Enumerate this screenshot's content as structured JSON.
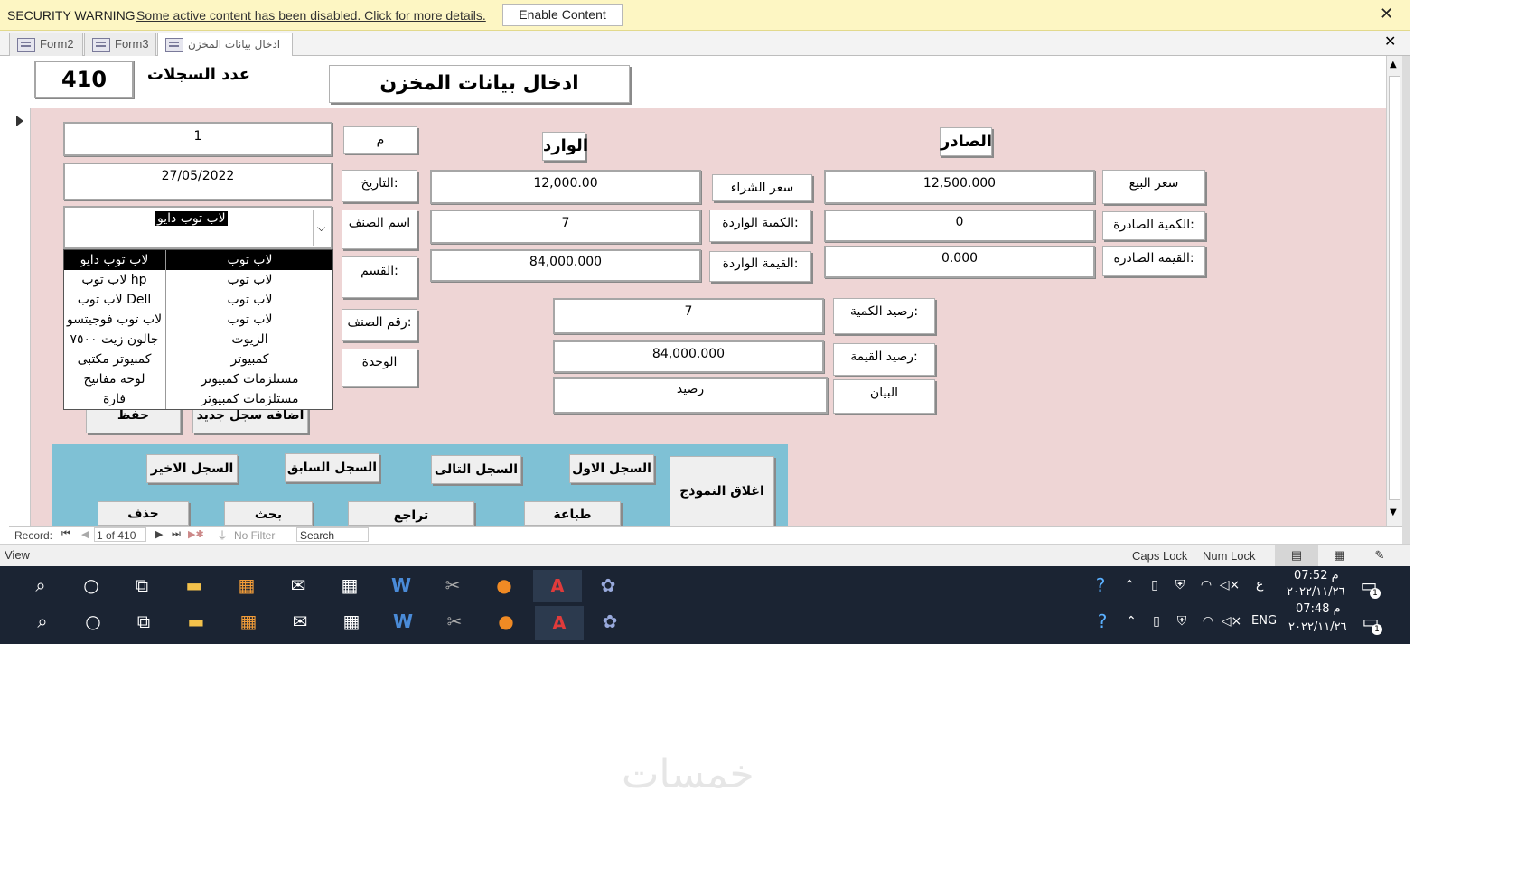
{
  "security_bar": {
    "title": "SECURITY WARNING",
    "message": "Some active content has been disabled. Click for more details.",
    "enable_button": "Enable Content",
    "close": "✕"
  },
  "tabs": [
    {
      "label": "Form2"
    },
    {
      "label": "Form3"
    },
    {
      "label": "ادخال بيانات المخزن"
    }
  ],
  "tab_close": "✕",
  "header": {
    "record_count_value": "410",
    "record_count_label": "عدد السجلات",
    "form_title": "ادخال بيانات المخزن"
  },
  "fields": {
    "serial": {
      "label": "م",
      "value": "1"
    },
    "date": {
      "label": "التاريخ:",
      "value": "27/05/2022"
    },
    "item_name": {
      "label": "اسم الصنف",
      "value": "لاب توب دايو"
    },
    "category": {
      "label": "القسم:"
    },
    "item_number": {
      "label": "رقم الصنف:"
    },
    "unit": {
      "label": "الوحدة"
    }
  },
  "incoming": {
    "heading": "الوارد",
    "purchase_price": {
      "label": "سعر الشراء",
      "value": "12,000.00"
    },
    "quantity": {
      "label": "الكمية الواردة:",
      "value": "7"
    },
    "value": {
      "label": "القيمة الواردة:",
      "value": "84,000.000"
    }
  },
  "outgoing": {
    "heading": "الصادر",
    "sale_price": {
      "label": "سعر البيع",
      "value": "12,500.000"
    },
    "quantity": {
      "label": "الكمية الصادرة:",
      "value": "0"
    },
    "value": {
      "label": "القيمة الصادرة:",
      "value": "0.000"
    }
  },
  "balance": {
    "quantity": {
      "label": "رصيد الكمية:",
      "value": "7"
    },
    "value": {
      "label": "رصيد القيمة:",
      "value": "84,000.000"
    },
    "statement": {
      "label": "البيان",
      "value": "رصيد"
    }
  },
  "dropdown": {
    "rows": [
      {
        "name": "لاب توب دايو",
        "category": "لاب توب"
      },
      {
        "name": "لاب توب hp",
        "category": "لاب توب"
      },
      {
        "name": "لاب توب Dell",
        "category": "لاب توب"
      },
      {
        "name": "لاب توب فوجيتسو",
        "category": "لاب توب"
      },
      {
        "name": "جالون زيت ٧٥٠٠",
        "category": "الزيوت"
      },
      {
        "name": "كمبيوتر مكتبى",
        "category": "كمبيوتر"
      },
      {
        "name": "لوحة مفاتيح",
        "category": "مستلزمات كمبيوتر"
      },
      {
        "name": "فارة",
        "category": "مستلزمات كمبيوتر"
      }
    ]
  },
  "buttons": {
    "save": "حفظ",
    "add_new": "اضافه سجل جديد",
    "last_record": "السجل الاخير",
    "previous_record": "السجل السابق",
    "next_record": "السجل التالى",
    "first_record": "السجل الاول",
    "close_form": "اغلاق النموذج",
    "delete": "حذف",
    "search": "بحث",
    "undo": "تراجع",
    "print": "طباعة"
  },
  "record_nav": {
    "label": "Record:",
    "position": "1 of 410",
    "filter": "No Filter",
    "search": "Search"
  },
  "status_bar": {
    "mode": "View",
    "caps": "Caps Lock",
    "num": "Num Lock"
  },
  "taskbar_top": {
    "lang": "ع",
    "time": "07:52 م",
    "date": "٢٠٢٢/١١/٢٦"
  },
  "taskbar_bottom": {
    "lang": "ENG",
    "time": "07:48 م",
    "date": "٢٠٢٢/١١/٢٦"
  },
  "notifications_count": "1",
  "watermark": "خمسات",
  "colors": {
    "form_body": "#eed5d5",
    "nav_panel": "#7fc1d5",
    "security_bar": "#fdf6c3",
    "taskbar": "#1b2433"
  }
}
